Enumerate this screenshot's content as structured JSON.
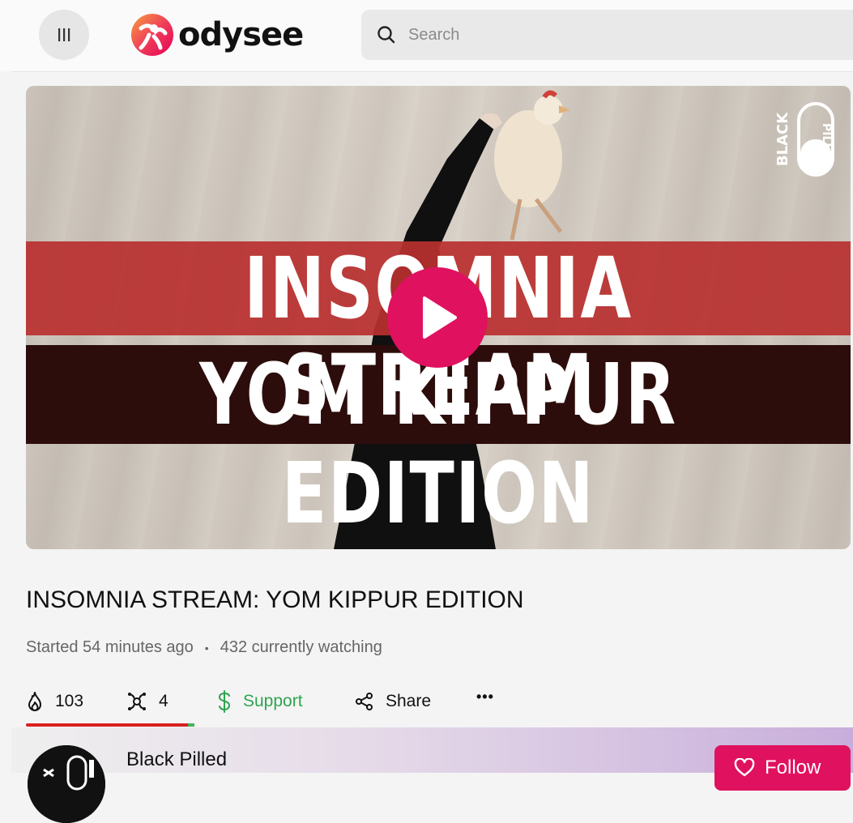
{
  "header": {
    "logo_text": "odysee",
    "search_placeholder": "Search"
  },
  "video": {
    "headline_line1": "INSOMNIA STREAM",
    "headline_line2": "YOM KIPPUR EDITION",
    "watermark_text": "BLACK PILLED"
  },
  "stream": {
    "title": "INSOMNIA STREAM: YOM KIPPUR EDITION",
    "started": "Started 54 minutes ago",
    "separator": "•",
    "watching": "432 currently watching"
  },
  "actions": {
    "fire_count": "103",
    "slime_count": "4",
    "support_label": "Support",
    "share_label": "Share",
    "more_label": "•••",
    "like_ratio": 0.96
  },
  "channel": {
    "name": "Black Pilled",
    "follow_label": "Follow"
  },
  "colors": {
    "accent": "#e0115f",
    "support": "#2ea44f",
    "fire_bar": "#d92020",
    "slime_bar": "#41b45a"
  },
  "icons": [
    "menu-icon",
    "odysee-logo-icon",
    "search-icon",
    "play-icon",
    "fire-icon",
    "slime-icon",
    "dollar-icon",
    "share-icon",
    "more-icon",
    "heart-icon"
  ]
}
